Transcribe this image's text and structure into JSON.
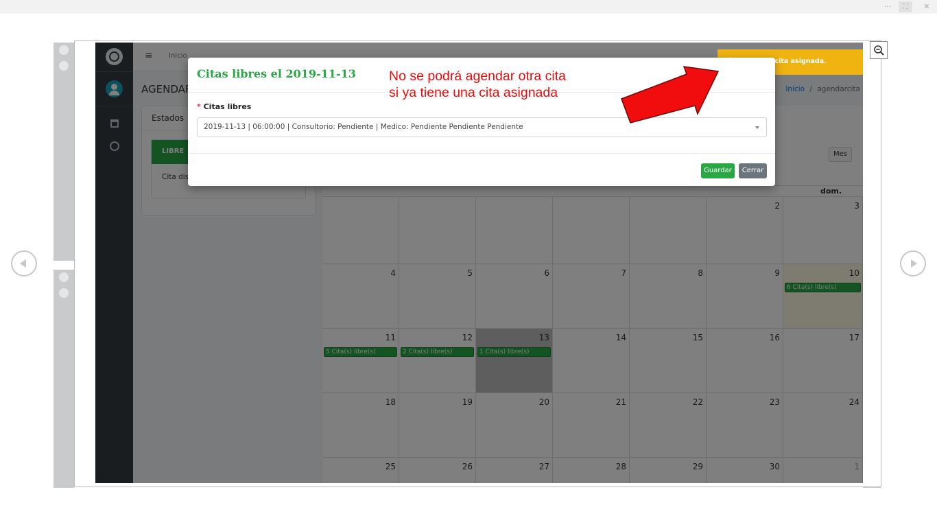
{
  "viewer": {
    "top_icons": [
      "···",
      "⛶",
      "✕"
    ]
  },
  "app": {
    "topnav": {
      "menu_icon": "≡",
      "breadcrumb_start": "Inicio"
    },
    "page_title": "AGENDAR",
    "breadcrumb": {
      "home": "Inicio",
      "separator": "/",
      "current": "agendarcita"
    },
    "estados": {
      "title": "Estados",
      "badge": "LIBRE",
      "text": "Cita dis"
    },
    "calendar": {
      "view_button": "Mes",
      "header_visible": "dom.",
      "weeks": [
        [
          {
            "n": ""
          },
          {
            "n": ""
          },
          {
            "n": ""
          },
          {
            "n": ""
          },
          {
            "n": ""
          },
          {
            "n": "2"
          },
          {
            "n": "3"
          }
        ],
        [
          {
            "n": "4"
          },
          {
            "n": "5"
          },
          {
            "n": "6"
          },
          {
            "n": "7"
          },
          {
            "n": "8"
          },
          {
            "n": "9"
          },
          {
            "n": "10",
            "ev": "6 Cita(s) libre(s)"
          }
        ],
        [
          {
            "n": "11",
            "ev": "5 Cita(s) libre(s)"
          },
          {
            "n": "12",
            "ev": "2 Cita(s) libre(s)"
          },
          {
            "n": "13",
            "ev": "1 Cita(s) libre(s)"
          },
          {
            "n": "14"
          },
          {
            "n": "15"
          },
          {
            "n": "16"
          },
          {
            "n": "17"
          }
        ],
        [
          {
            "n": "18"
          },
          {
            "n": "19"
          },
          {
            "n": "20"
          },
          {
            "n": "21"
          },
          {
            "n": "22"
          },
          {
            "n": "23"
          },
          {
            "n": "24"
          }
        ],
        [
          {
            "n": "25"
          },
          {
            "n": "26"
          },
          {
            "n": "27"
          },
          {
            "n": "28"
          },
          {
            "n": "29"
          },
          {
            "n": "30"
          },
          {
            "n": "1"
          }
        ]
      ]
    }
  },
  "modal": {
    "title": "Citas libres el 2019-11-13",
    "required_mark": "*",
    "field_label": "Citas libres",
    "selected_option": "2019-11-13 | 06:00:00 | Consultorio: Pendiente | Medico: Pendiente Pendiente Pendiente",
    "save_button": "Guardar",
    "close_button": "Cerrar"
  },
  "toast": {
    "message": "Ya tiene cita asignada."
  },
  "annotation": {
    "line1": "No se podrá agendar otra cita",
    "line2": "si ya tiene una cita asignada"
  },
  "colors": {
    "success": "#28a745",
    "warning": "#f0b411",
    "annotation": "#ee0a0a",
    "sidebar": "#343a40",
    "primary": "#007bff"
  }
}
